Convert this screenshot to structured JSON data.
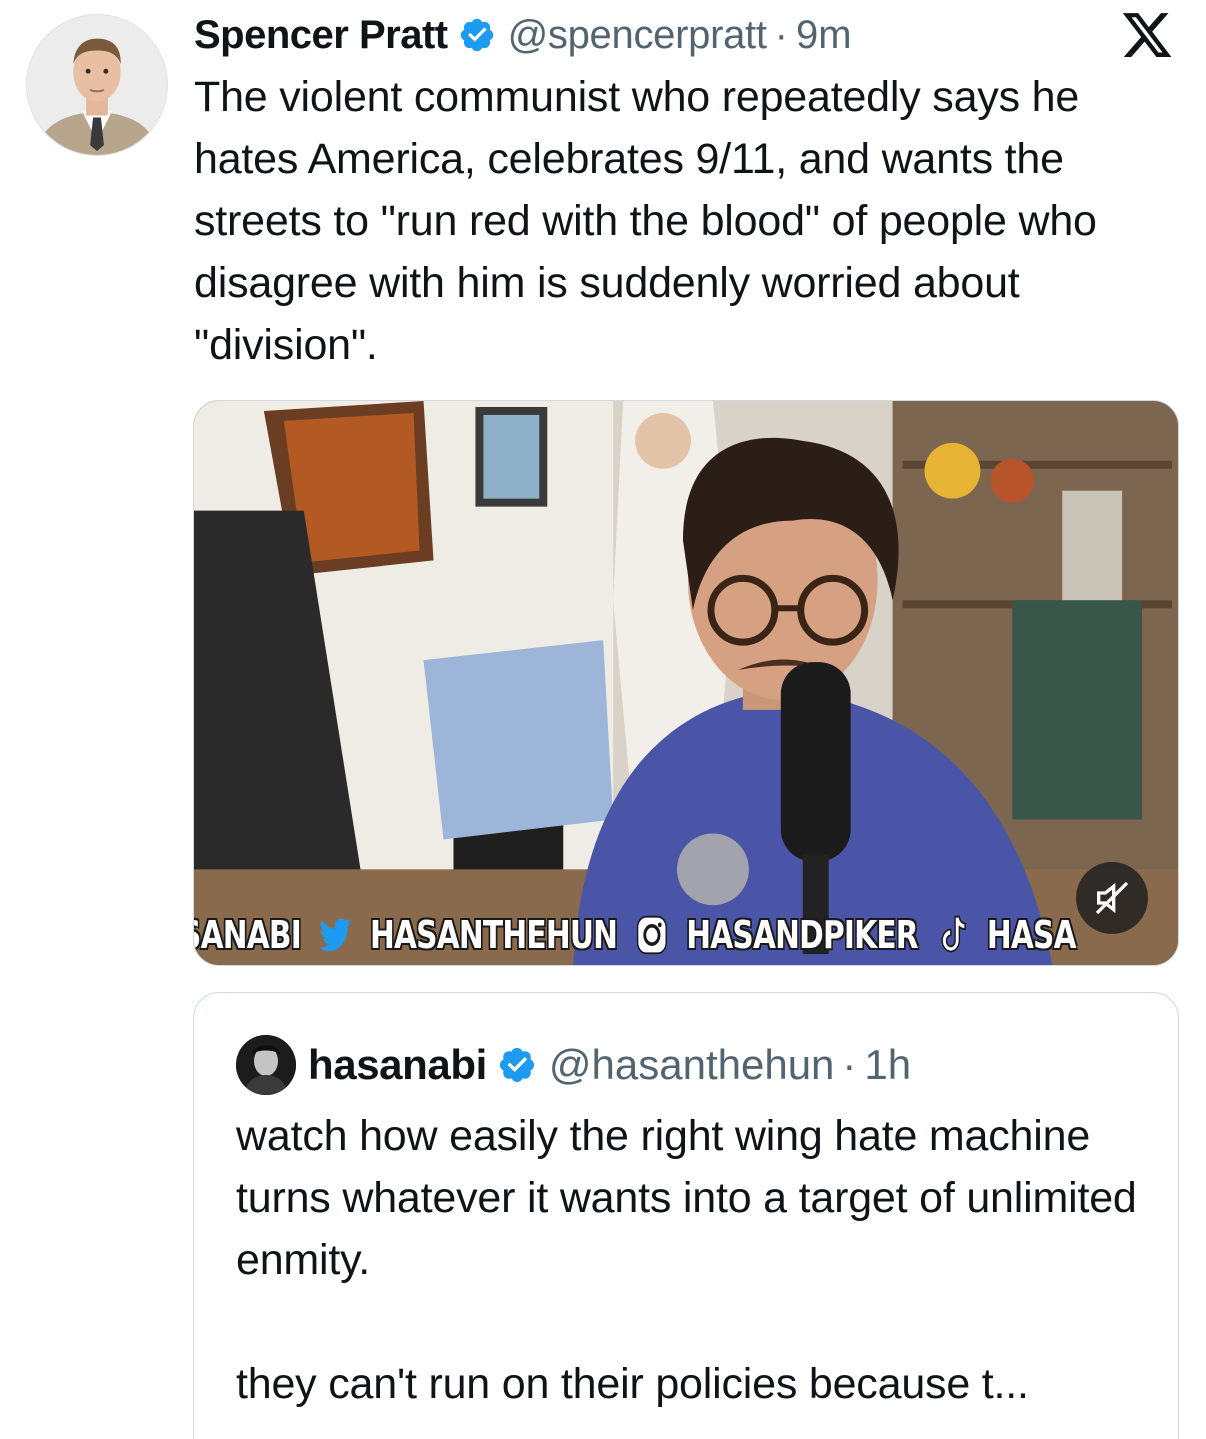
{
  "tweet": {
    "author_name": "Spencer Pratt",
    "handle": "@spencerpratt",
    "separator": "·",
    "time": "9m",
    "text": "The violent communist who repeatedly says he hates America, celebrates 9/11, and wants the streets to \"run red with the blood\" of people who disagree with him is suddenly worried about \"division\".",
    "verified_color": "#1d9bf0",
    "media": {
      "ticker": {
        "seg1": "SANABI",
        "seg2": "HASANTHEHUN",
        "seg3": "HASANDPIKER",
        "seg4": "HASA"
      },
      "mute_icon": "speaker-muted-icon"
    }
  },
  "quote": {
    "author_name": "hasanabi",
    "handle": "@hasanthehun",
    "separator": "·",
    "time": "1h",
    "text_p1": "watch how easily the right wing hate machine turns whatever it wants into a target of unlimited enmity.",
    "text_p2": "they can't run on their policies because t..."
  },
  "brand": {
    "logo": "x-logo-icon"
  }
}
